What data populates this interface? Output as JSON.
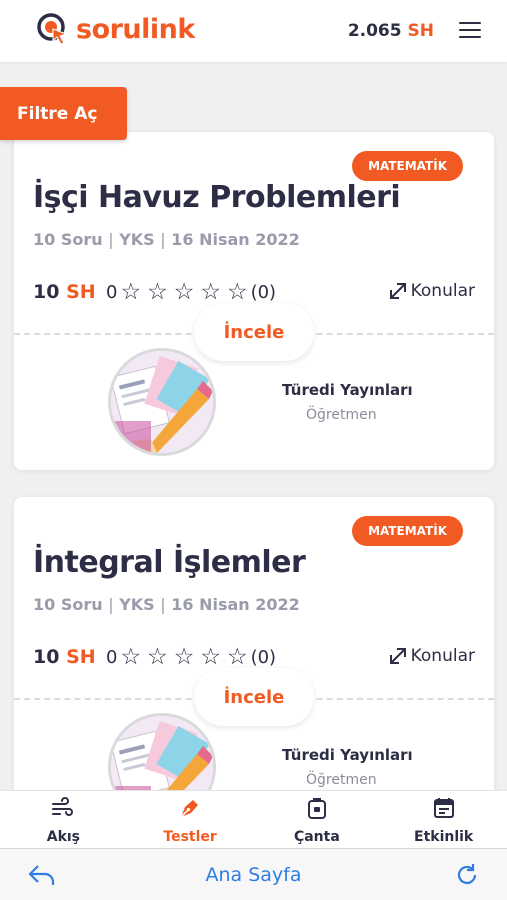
{
  "header": {
    "logo_text": "sorulink",
    "balance_value": "2.065",
    "balance_unit": "SH",
    "accent_color": "#f15a22"
  },
  "filter": {
    "label": "Filtre Aç"
  },
  "cards": [
    {
      "tag": "MATEMATİK",
      "title": "İşçi Havuz Problemleri",
      "meta": {
        "count": "10 Soru",
        "sep1": "|",
        "exam": "YKS",
        "sep2": "|",
        "date": "16 Nisan 2022"
      },
      "price_value": "10",
      "price_unit": "SH",
      "rating_value": "0",
      "rating_stars": [
        "☆",
        "☆",
        "☆",
        "☆",
        "☆"
      ],
      "rating_count": "(0)",
      "topics_label": "Konular",
      "inspect_label": "İncele",
      "publisher": "Türedi Yayınları",
      "role": "Öğretmen"
    },
    {
      "tag": "MATEMATİK",
      "title": "İntegral İşlemler",
      "meta": {
        "count": "10 Soru",
        "sep1": "|",
        "exam": "YKS",
        "sep2": "|",
        "date": "16 Nisan 2022"
      },
      "price_value": "10",
      "price_unit": "SH",
      "rating_value": "0",
      "rating_stars": [
        "☆",
        "☆",
        "☆",
        "☆",
        "☆"
      ],
      "rating_count": "(0)",
      "topics_label": "Konular",
      "inspect_label": "İncele",
      "publisher": "Türedi Yayınları",
      "role": "Öğretmen"
    }
  ],
  "tabbar": {
    "items": [
      {
        "label": "Akış",
        "icon": "wind-icon",
        "active": false
      },
      {
        "label": "Testler",
        "icon": "pen-nib-icon",
        "active": true
      },
      {
        "label": "Çanta",
        "icon": "bag-icon",
        "active": false
      },
      {
        "label": "Etkinlik",
        "icon": "calendar-icon",
        "active": false
      }
    ]
  },
  "browser": {
    "title": "Ana Sayfa",
    "back_icon": "reply-arrow-icon",
    "reload_icon": "reload-icon"
  }
}
